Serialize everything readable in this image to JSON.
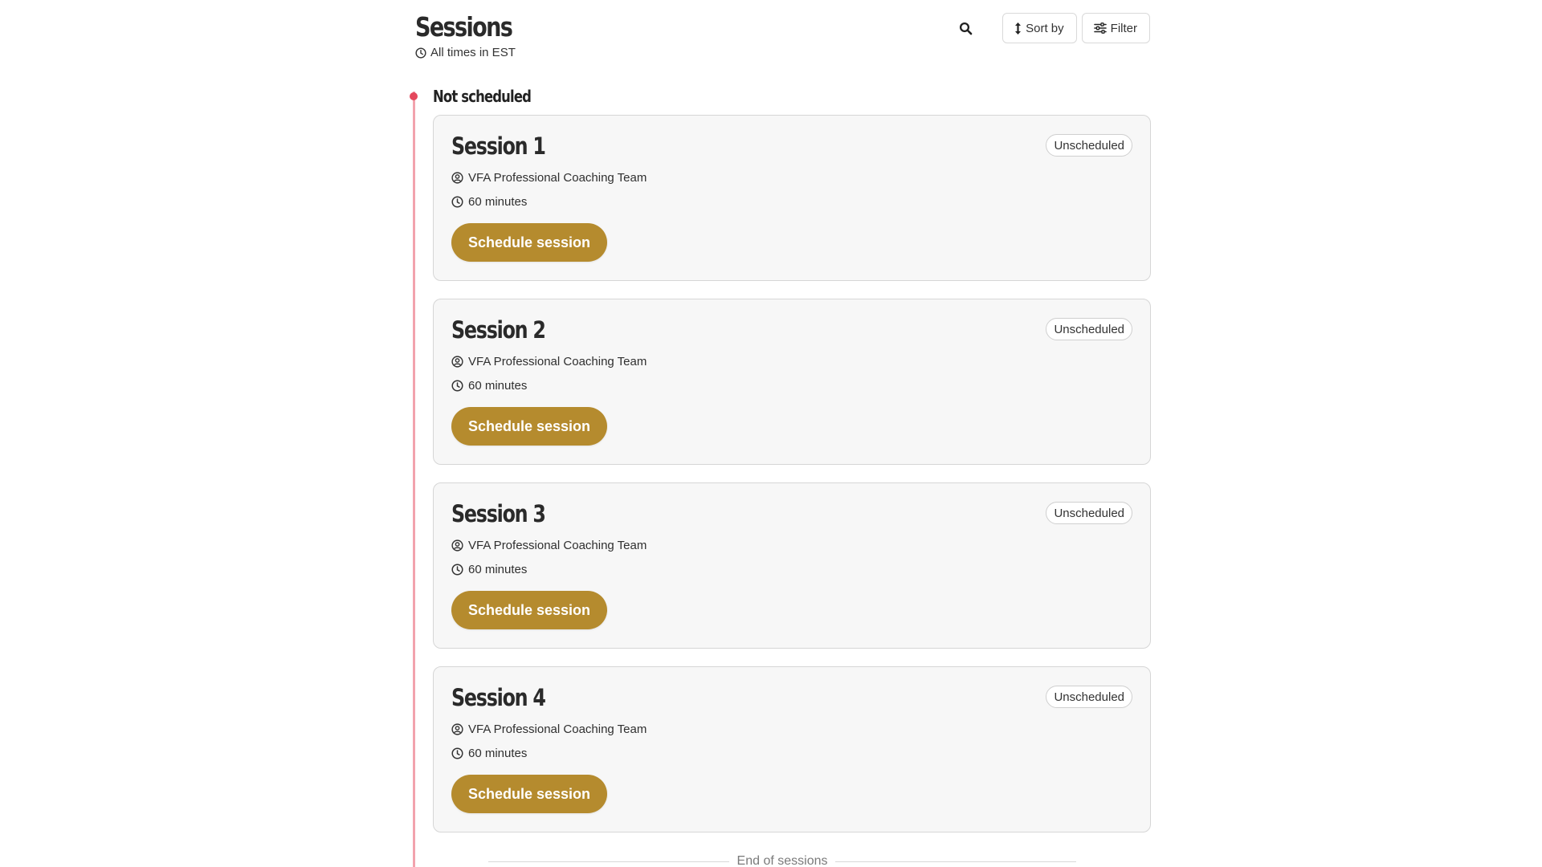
{
  "header": {
    "title": "Sessions",
    "timezone_note": "All times in EST"
  },
  "toolbar": {
    "sort_label": "Sort by",
    "filter_label": "Filter"
  },
  "group": {
    "label": "Not scheduled"
  },
  "sessions": [
    {
      "title": "Session 1",
      "status": "Unscheduled",
      "team": "VFA Professional Coaching Team",
      "duration": "60 minutes",
      "action_label": "Schedule session"
    },
    {
      "title": "Session 2",
      "status": "Unscheduled",
      "team": "VFA Professional Coaching Team",
      "duration": "60 minutes",
      "action_label": "Schedule session"
    },
    {
      "title": "Session 3",
      "status": "Unscheduled",
      "team": "VFA Professional Coaching Team",
      "duration": "60 minutes",
      "action_label": "Schedule session"
    },
    {
      "title": "Session 4",
      "status": "Unscheduled",
      "team": "VFA Professional Coaching Team",
      "duration": "60 minutes",
      "action_label": "Schedule session"
    }
  ],
  "footer": {
    "end_label": "End of sessions"
  },
  "colors": {
    "accent": "#b58b2e",
    "timeline": "#f2a3ad",
    "timeline_dot": "#e4475c",
    "card_background": "#f7f7f7"
  },
  "icons": {
    "timezone": "clock-icon",
    "search": "search-icon",
    "sort": "sort-arrows-icon",
    "filter": "sliders-icon",
    "team": "user-circle-icon",
    "duration": "clock-icon"
  }
}
